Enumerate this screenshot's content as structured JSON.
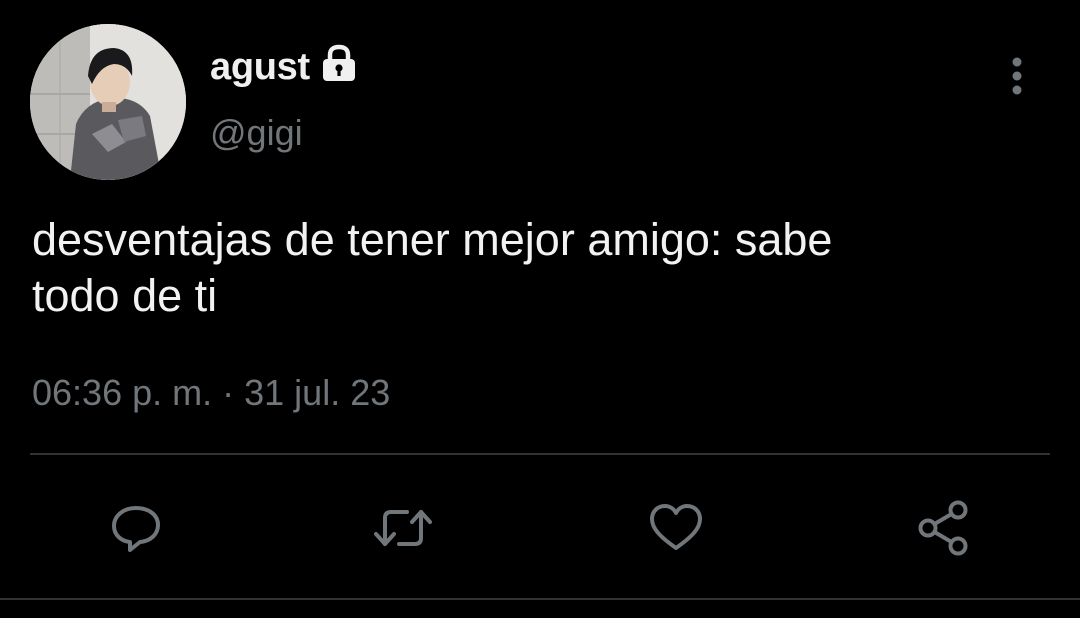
{
  "author": {
    "display_name": "agust",
    "handle": "@gigi",
    "protected": true
  },
  "tweet": {
    "text_line1": "desventajas de tener mejor amigo: sabe",
    "text_line2": "todo de ti",
    "time": "06:36 p. m.",
    "separator": "·",
    "date": "31 jul. 23"
  },
  "icons": {
    "lock": "lock-icon",
    "more": "more-vertical-icon",
    "reply": "reply-icon",
    "retweet": "retweet-icon",
    "like": "heart-icon",
    "share": "share-icon"
  },
  "colors": {
    "background": "#000000",
    "text": "#e7e9ea",
    "secondary_text": "#71767b",
    "divider": "#2f3336"
  }
}
